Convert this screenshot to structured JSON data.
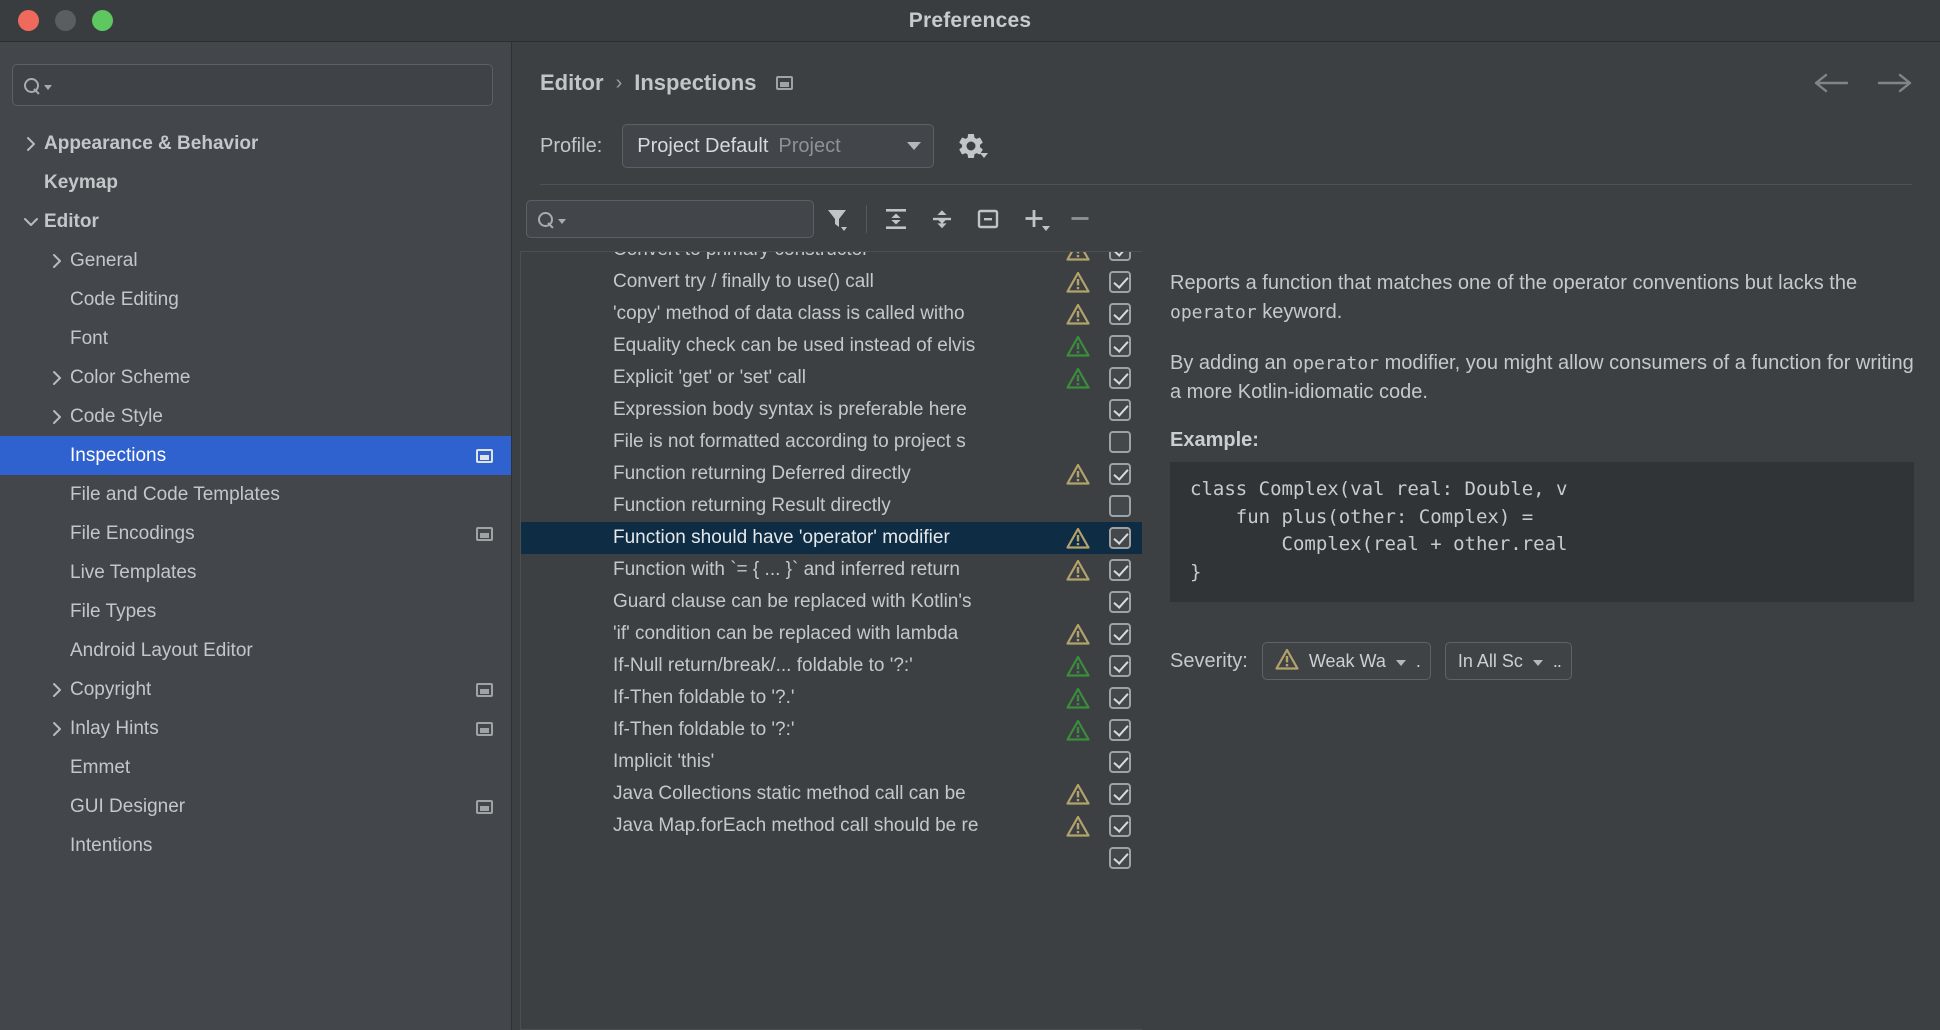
{
  "window": {
    "title": "Preferences",
    "traffic_lights": [
      "close",
      "minimize",
      "zoom"
    ]
  },
  "sidebar": {
    "search": {
      "value": "",
      "placeholder": "",
      "icon": "search-icon"
    },
    "items": [
      {
        "label": "Appearance & Behavior",
        "depth": 0,
        "arrow": "right",
        "bold": true,
        "selected": false,
        "module_icon": false
      },
      {
        "label": "Keymap",
        "depth": 0,
        "arrow": "none",
        "bold": true,
        "selected": false,
        "module_icon": false
      },
      {
        "label": "Editor",
        "depth": 0,
        "arrow": "down",
        "bold": true,
        "selected": false,
        "module_icon": false
      },
      {
        "label": "General",
        "depth": 1,
        "arrow": "right",
        "bold": false,
        "selected": false,
        "module_icon": false
      },
      {
        "label": "Code Editing",
        "depth": 1,
        "arrow": "none",
        "bold": false,
        "selected": false,
        "module_icon": false
      },
      {
        "label": "Font",
        "depth": 1,
        "arrow": "none",
        "bold": false,
        "selected": false,
        "module_icon": false
      },
      {
        "label": "Color Scheme",
        "depth": 1,
        "arrow": "right",
        "bold": false,
        "selected": false,
        "module_icon": false
      },
      {
        "label": "Code Style",
        "depth": 1,
        "arrow": "right",
        "bold": false,
        "selected": false,
        "module_icon": false
      },
      {
        "label": "Inspections",
        "depth": 1,
        "arrow": "none",
        "bold": false,
        "selected": true,
        "module_icon": true
      },
      {
        "label": "File and Code Templates",
        "depth": 1,
        "arrow": "none",
        "bold": false,
        "selected": false,
        "module_icon": false
      },
      {
        "label": "File Encodings",
        "depth": 1,
        "arrow": "none",
        "bold": false,
        "selected": false,
        "module_icon": true
      },
      {
        "label": "Live Templates",
        "depth": 1,
        "arrow": "none",
        "bold": false,
        "selected": false,
        "module_icon": false
      },
      {
        "label": "File Types",
        "depth": 1,
        "arrow": "none",
        "bold": false,
        "selected": false,
        "module_icon": false
      },
      {
        "label": "Android Layout Editor",
        "depth": 1,
        "arrow": "none",
        "bold": false,
        "selected": false,
        "module_icon": false
      },
      {
        "label": "Copyright",
        "depth": 1,
        "arrow": "right",
        "bold": false,
        "selected": false,
        "module_icon": true
      },
      {
        "label": "Inlay Hints",
        "depth": 1,
        "arrow": "right",
        "bold": false,
        "selected": false,
        "module_icon": true
      },
      {
        "label": "Emmet",
        "depth": 1,
        "arrow": "none",
        "bold": false,
        "selected": false,
        "module_icon": false
      },
      {
        "label": "GUI Designer",
        "depth": 1,
        "arrow": "none",
        "bold": false,
        "selected": false,
        "module_icon": true
      },
      {
        "label": "Intentions",
        "depth": 1,
        "arrow": "none",
        "bold": false,
        "selected": false,
        "module_icon": false
      }
    ]
  },
  "header": {
    "breadcrumb": [
      "Editor",
      "Inspections"
    ],
    "breadcrumb_separator": "›",
    "module_icon": "module-scope-icon",
    "nav_back": "back-arrow-icon",
    "nav_forward": "forward-arrow-icon"
  },
  "profile": {
    "label": "Profile:",
    "value": "Project Default",
    "scope": "Project",
    "gear": "gear-icon"
  },
  "toolbar": {
    "search": {
      "value": "",
      "placeholder": "",
      "icon": "search-icon"
    },
    "buttons": [
      {
        "name": "filter-icon",
        "title": "Filter"
      },
      {
        "name": "expand-all-icon",
        "title": "Expand All"
      },
      {
        "name": "collapse-all-icon",
        "title": "Collapse All"
      },
      {
        "name": "reset-icon",
        "title": "Reset"
      },
      {
        "name": "add-icon",
        "title": "Add"
      },
      {
        "name": "remove-icon",
        "title": "Remove"
      }
    ]
  },
  "inspections": {
    "rows": [
      {
        "label": "Convert to primary constructor",
        "severity": "weak-warning",
        "checked": true,
        "selected": false,
        "clipped_top": true
      },
      {
        "label": "Convert try / finally to use() call",
        "severity": "weak-warning",
        "checked": true,
        "selected": false
      },
      {
        "label": "'copy' method of data class is called witho",
        "severity": "weak-warning",
        "checked": true,
        "selected": false
      },
      {
        "label": "Equality check can be used instead of elvis",
        "severity": "info",
        "checked": true,
        "selected": false
      },
      {
        "label": "Explicit 'get' or 'set' call",
        "severity": "info",
        "checked": true,
        "selected": false
      },
      {
        "label": "Expression body syntax is preferable here",
        "severity": "none",
        "checked": true,
        "selected": false
      },
      {
        "label": "File is not formatted according to project s",
        "severity": "none",
        "checked": false,
        "selected": false
      },
      {
        "label": "Function returning Deferred directly",
        "severity": "weak-warning",
        "checked": true,
        "selected": false
      },
      {
        "label": "Function returning Result directly",
        "severity": "none",
        "checked": false,
        "selected": false
      },
      {
        "label": "Function should have 'operator' modifier",
        "severity": "weak-warning",
        "checked": true,
        "selected": true
      },
      {
        "label": "Function with `= { ... }` and inferred return",
        "severity": "weak-warning",
        "checked": true,
        "selected": false
      },
      {
        "label": "Guard clause can be replaced with Kotlin's",
        "severity": "none",
        "checked": true,
        "selected": false
      },
      {
        "label": "'if' condition can be replaced with lambda",
        "severity": "weak-warning",
        "checked": true,
        "selected": false
      },
      {
        "label": "If-Null return/break/... foldable to '?:'",
        "severity": "info",
        "checked": true,
        "selected": false
      },
      {
        "label": "If-Then foldable to '?.'",
        "severity": "info",
        "checked": true,
        "selected": false
      },
      {
        "label": "If-Then foldable to '?:'",
        "severity": "info",
        "checked": true,
        "selected": false
      },
      {
        "label": "Implicit 'this'",
        "severity": "none",
        "checked": true,
        "selected": false
      },
      {
        "label": "Java Collections static method call can be",
        "severity": "weak-warning",
        "checked": true,
        "selected": false
      },
      {
        "label": "Java Map.forEach method call should be re",
        "severity": "weak-warning",
        "checked": true,
        "selected": false
      },
      {
        "label": "",
        "severity": "none",
        "checked": true,
        "selected": false,
        "clipped_bottom": true
      }
    ]
  },
  "description": {
    "paragraph1_pre": "Reports a function that matches one of the operator conventions but lacks the ",
    "paragraph1_code": "operator",
    "paragraph1_post": " keyword.",
    "paragraph2_pre": "By adding an ",
    "paragraph2_code": "operator",
    "paragraph2_post": " modifier, you might allow consumers of a function for writing a more Kotlin-idiomatic code.",
    "example_title": "Example:",
    "code_lines": [
      "class Complex(val real: Double, v",
      "    fun plus(other: Complex) =",
      "        Complex(real + other.real",
      "}"
    ]
  },
  "severity": {
    "label": "Severity:",
    "level_button": {
      "icon": "weak-warning-icon",
      "text": "Weak Wa",
      "ellipsis": "."
    },
    "scope_button": {
      "text": "In All Sc",
      "ellipsis": ".."
    }
  },
  "colors": {
    "selection_blue": "#2f62cf",
    "row_selected": "#0e2c44",
    "weak_warning": "#b4a26b",
    "info_green": "#3c8c3c",
    "window_bg": "#3c4043",
    "sidebar_bg": "#43474b",
    "code_bg": "#313436"
  }
}
